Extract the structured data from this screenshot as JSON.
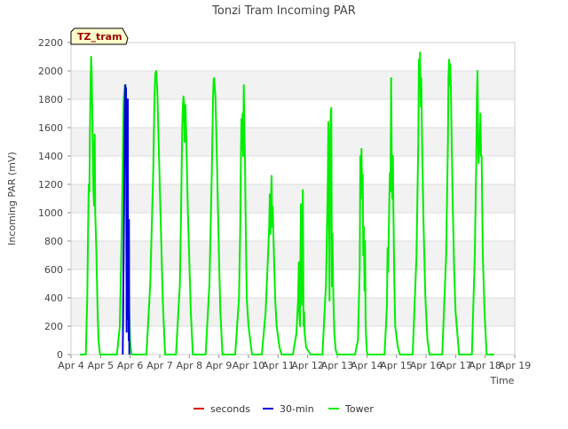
{
  "chart_data": {
    "type": "line",
    "title": "Tonzi Tram Incoming PAR",
    "xlabel": "Time",
    "ylabel": "Incoming PAR (mV)",
    "badge": "TZ_tram",
    "ylim": [
      0,
      2200
    ],
    "xlim": [
      4,
      19
    ],
    "yticks": [
      0,
      200,
      400,
      600,
      800,
      1000,
      1200,
      1400,
      1600,
      1800,
      2000,
      2200
    ],
    "xticks": [
      {
        "v": 4,
        "label": "Apr 4"
      },
      {
        "v": 5,
        "label": "Apr 5"
      },
      {
        "v": 6,
        "label": "Apr 6"
      },
      {
        "v": 7,
        "label": "Apr 7"
      },
      {
        "v": 8,
        "label": "Apr 8"
      },
      {
        "v": 9,
        "label": "Apr 9"
      },
      {
        "v": 10,
        "label": "Apr 10"
      },
      {
        "v": 11,
        "label": "Apr 11"
      },
      {
        "v": 12,
        "label": "Apr 12"
      },
      {
        "v": 13,
        "label": "Apr 13"
      },
      {
        "v": 14,
        "label": "Apr 14"
      },
      {
        "v": 15,
        "label": "Apr 15"
      },
      {
        "v": 16,
        "label": "Apr 16"
      },
      {
        "v": 17,
        "label": "Apr 17"
      },
      {
        "v": 18,
        "label": "Apr 18"
      },
      {
        "v": 19,
        "label": "Apr 19"
      }
    ],
    "grid": true,
    "legend_position": "bottom",
    "series": [
      {
        "name": "seconds",
        "color": "#dd0000",
        "x": [],
        "y": []
      },
      {
        "name": "30-min",
        "color": "#0000dd",
        "x": [
          5.75,
          5.8,
          5.82,
          5.84,
          5.85,
          5.86,
          5.87,
          5.88,
          5.89,
          5.9,
          5.91,
          5.92,
          5.93,
          5.94,
          5.95,
          5.96,
          5.97
        ],
        "y": [
          0,
          1200,
          1750,
          1900,
          1650,
          1880,
          1200,
          160,
          1550,
          1170,
          250,
          1800,
          300,
          700,
          100,
          950,
          0
        ]
      },
      {
        "name": "Tower",
        "color": "#00ee00",
        "x": [
          4.3,
          4.5,
          4.55,
          4.58,
          4.6,
          4.62,
          4.64,
          4.66,
          4.68,
          4.7,
          4.72,
          4.74,
          4.76,
          4.78,
          4.8,
          4.82,
          4.84,
          4.86,
          4.88,
          4.9,
          4.93,
          4.98,
          5.1,
          5.55,
          5.65,
          5.72,
          5.78,
          5.82,
          5.84,
          5.86,
          5.88,
          5.9,
          5.92,
          5.94,
          5.96,
          5.98,
          6.0,
          6.05,
          6.1,
          6.55,
          6.68,
          6.78,
          6.82,
          6.85,
          6.88,
          6.92,
          7.0,
          7.1,
          7.18,
          7.55,
          7.68,
          7.72,
          7.76,
          7.78,
          7.8,
          7.82,
          7.84,
          7.87,
          7.9,
          7.95,
          8.05,
          8.12,
          8.55,
          8.68,
          8.76,
          8.8,
          8.82,
          8.84,
          8.88,
          8.92,
          9.0,
          9.05,
          9.12,
          9.55,
          9.68,
          9.72,
          9.74,
          9.76,
          9.78,
          9.8,
          9.82,
          9.84,
          9.86,
          9.88,
          9.9,
          9.94,
          10.0,
          10.12,
          10.45,
          10.58,
          10.66,
          10.7,
          10.72,
          10.74,
          10.76,
          10.78,
          10.8,
          10.82,
          10.84,
          10.86,
          10.9,
          10.95,
          11.05,
          11.12,
          11.5,
          11.62,
          11.68,
          11.7,
          11.72,
          11.74,
          11.75,
          11.77,
          11.79,
          11.8,
          11.82,
          11.84,
          11.86,
          11.88,
          11.9,
          11.95,
          12.1,
          12.5,
          12.62,
          12.68,
          12.7,
          12.72,
          12.74,
          12.76,
          12.78,
          12.8,
          12.82,
          12.84,
          12.86,
          12.88,
          12.9,
          12.95,
          13.0,
          13.6,
          13.7,
          13.76,
          13.78,
          13.8,
          13.82,
          13.84,
          13.86,
          13.88,
          13.9,
          13.92,
          13.94,
          13.96,
          13.98,
          14.0,
          14.02,
          14.05,
          14.6,
          14.68,
          14.7,
          14.72,
          14.76,
          14.78,
          14.8,
          14.82,
          14.84,
          14.86,
          14.88,
          14.9,
          14.93,
          14.96,
          15.05,
          15.12,
          15.55,
          15.68,
          15.74,
          15.76,
          15.78,
          15.8,
          15.82,
          15.84,
          15.86,
          15.88,
          15.92,
          15.98,
          16.05,
          16.12,
          16.55,
          16.68,
          16.74,
          16.76,
          16.78,
          16.8,
          16.82,
          16.84,
          16.86,
          16.9,
          16.95,
          17.0,
          17.12,
          17.55,
          17.65,
          17.7,
          17.72,
          17.74,
          17.76,
          17.78,
          17.8,
          17.82,
          17.84,
          17.86,
          17.88,
          17.92,
          17.98,
          18.05,
          18.3
        ],
        "y": [
          0,
          0,
          400,
          900,
          1200,
          1150,
          1550,
          1900,
          2100,
          2000,
          1700,
          1400,
          1150,
          1050,
          1550,
          1000,
          850,
          700,
          500,
          300,
          100,
          0,
          0,
          0,
          200,
          900,
          1800,
          1900,
          1750,
          1820,
          1400,
          1300,
          1000,
          700,
          400,
          200,
          80,
          0,
          0,
          0,
          500,
          1300,
          1800,
          1980,
          2000,
          1850,
          1200,
          400,
          0,
          0,
          500,
          1000,
          1600,
          1750,
          1820,
          1780,
          1500,
          1760,
          1500,
          1000,
          300,
          0,
          0,
          500,
          1300,
          1800,
          1940,
          1950,
          1820,
          1500,
          700,
          300,
          0,
          0,
          400,
          900,
          1300,
          1660,
          1450,
          1700,
          1400,
          1900,
          1600,
          1400,
          1000,
          400,
          200,
          0,
          0,
          300,
          700,
          900,
          1130,
          850,
          1100,
          1260,
          900,
          1040,
          850,
          700,
          400,
          200,
          50,
          0,
          0,
          150,
          400,
          650,
          300,
          200,
          500,
          1060,
          350,
          600,
          900,
          1160,
          200,
          300,
          150,
          50,
          0,
          0,
          500,
          1200,
          1640,
          800,
          380,
          1500,
          1700,
          1740,
          480,
          850,
          500,
          300,
          150,
          30,
          0,
          0,
          100,
          600,
          1400,
          1100,
          1450,
          1150,
          1270,
          700,
          900,
          450,
          800,
          200,
          100,
          30,
          0,
          0,
          0,
          350,
          750,
          580,
          1100,
          1280,
          1150,
          1950,
          1450,
          1100,
          1400,
          1000,
          500,
          200,
          50,
          0,
          0,
          700,
          1500,
          2080,
          1950,
          2130,
          1750,
          1950,
          1620,
          1350,
          900,
          400,
          100,
          0,
          0,
          700,
          1500,
          1950,
          2080,
          1900,
          2050,
          1900,
          1600,
          1100,
          600,
          300,
          0,
          0,
          700,
          1400,
          1800,
          2000,
          1580,
          1350,
          1450,
          1500,
          1700,
          1400,
          1400,
          700,
          300,
          0,
          0
        ]
      }
    ]
  }
}
